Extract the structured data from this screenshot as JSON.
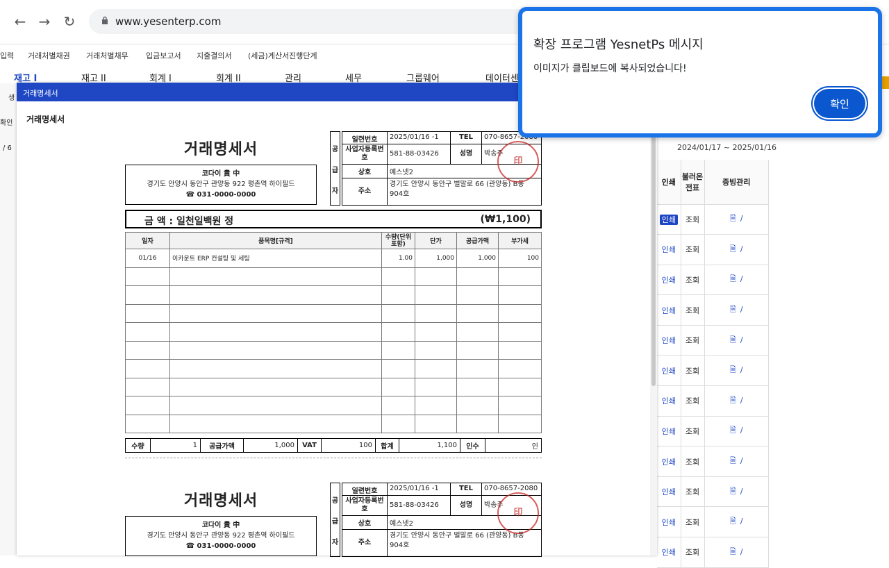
{
  "browser": {
    "url": "www.yesenterp.com",
    "back": "←",
    "forward": "→",
    "reload": "↻"
  },
  "top_menu": [
    "입력",
    "거래처별채권",
    "거래처별채무",
    "입금보고서",
    "지출결의서",
    "(세금)계산서진행단계"
  ],
  "main_menu": [
    "재고 I",
    "재고 II",
    "회계 I",
    "회계 II",
    "관리",
    "세무",
    "그룹웨어",
    "데이터센"
  ],
  "left_strip": {
    "item1": "생",
    "item2": "확인",
    "item3": "/ 6"
  },
  "modal": {
    "title": "거래명세서",
    "heading": "거래명세서"
  },
  "statement": {
    "title": "거래명세서",
    "buyer": {
      "name": "코다이 貴 中",
      "address": "경기도 안양시 동안구 관양동 922 평촌역 하이필드",
      "phone": "☎ 031-0000-0000"
    },
    "supplier_vertical": [
      "공",
      "급",
      "자"
    ],
    "serial_label": "일련번호",
    "serial": "2025/01/16 -1",
    "tel_label": "TEL",
    "tel": "070-8657-2080",
    "biz_label": "사업자등록번호",
    "biz_no": "581-88-03426",
    "name_label": "성명",
    "name": "박송주",
    "company_label": "상호",
    "company": "예스넷2",
    "addr_label": "주소",
    "addr": "경기도 안양시 동안구 벌말로 66 (관양동) B동 904호",
    "amount_text": "금  액 : 일천일백원 정",
    "amount_num": "(₩1,100)",
    "item_headers": [
      "일자",
      "품목명[규격]",
      "수량(단위포함)",
      "단가",
      "공급가액",
      "부가세"
    ],
    "items": [
      {
        "date": "01/16",
        "name": "이카운트 ERP 컨설팅 및 세팅",
        "qty": "1.00",
        "price": "1,000",
        "supply": "1,000",
        "vat": "100"
      }
    ],
    "totals": {
      "qty_label": "수량",
      "qty": "1",
      "supply_label": "공급가액",
      "supply": "1,000",
      "vat_label": "VAT",
      "vat": "100",
      "sum_label": "합계",
      "sum": "1,100",
      "recv_label": "인수",
      "recv": "인"
    }
  },
  "right_panel": {
    "date_range": "2024/01/17 ~ 2025/01/16",
    "headers": [
      "인쇄",
      "불러온 전표",
      "증빙관리"
    ],
    "print_label": "인쇄",
    "view_label": "조회",
    "row_count": 12
  },
  "popup": {
    "title": "확장 프로그램 YesnetPs 메시지",
    "message": "이미지가 클립보드에 복사되었습니다!",
    "ok": "확인"
  }
}
